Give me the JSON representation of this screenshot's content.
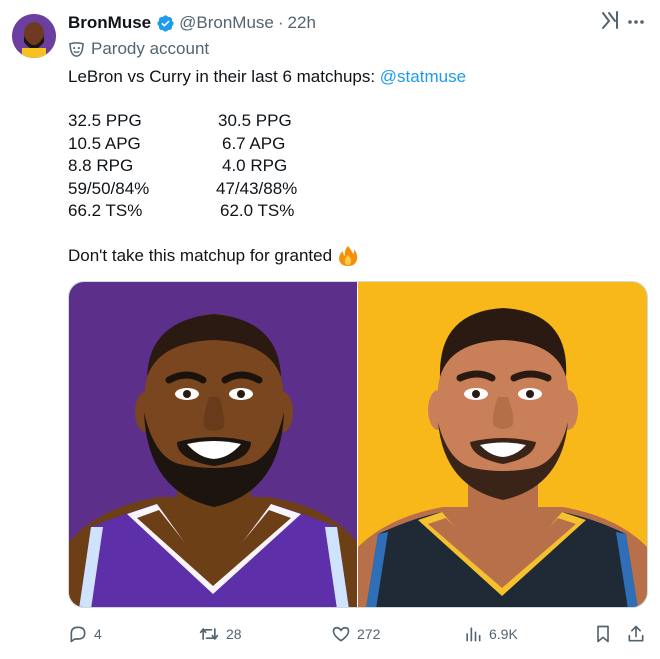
{
  "author": {
    "name": "BronMuse",
    "handle": "@BronMuse",
    "time": "22h",
    "dot": "·",
    "label": "Parody account"
  },
  "tweet": {
    "intro": "LeBron vs Curry in their last 6 matchups: ",
    "mention": "@statmuse",
    "stats": [
      {
        "left": "32.5 PPG",
        "right": "30.5 PPG"
      },
      {
        "left": "10.5 APG",
        "right": "6.7 APG"
      },
      {
        "left": "8.8 RPG",
        "right": "4.0 RPG"
      },
      {
        "left": "59/50/84%",
        "right": "47/43/88%"
      },
      {
        "left": "66.2 TS%",
        "right": "62.0 TS%"
      }
    ],
    "outro": "Don't take this matchup for granted"
  },
  "actions": {
    "replies": "4",
    "retweets": "28",
    "likes": "272",
    "views": "6.9K"
  },
  "colors": {
    "accent": "#1d9bf0",
    "left_panel": "#5b2f8a",
    "right_panel": "#f8b81a"
  }
}
